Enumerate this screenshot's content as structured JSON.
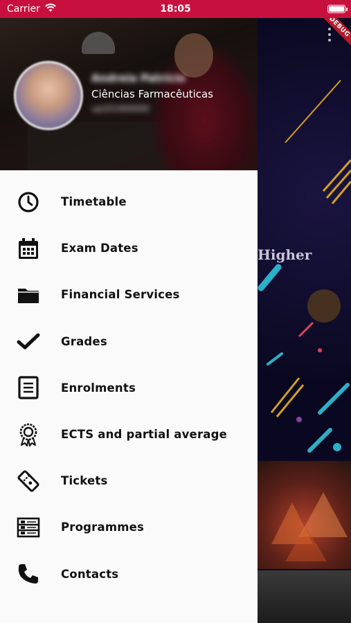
{
  "status_bar": {
    "carrier": "Carrier",
    "time": "18:05"
  },
  "debug_banner": "DEBUG",
  "background": {
    "heading_fragment": "Higher"
  },
  "profile": {
    "name": "Andreia Patrício",
    "course": "Ciências Farmacêuticas",
    "extra": "up201900000"
  },
  "menu": {
    "items": [
      {
        "label": "Timetable",
        "icon": "clock-icon"
      },
      {
        "label": "Exam Dates",
        "icon": "calendar-icon"
      },
      {
        "label": "Financial Services",
        "icon": "folder-icon"
      },
      {
        "label": "Grades",
        "icon": "checkmark-icon"
      },
      {
        "label": "Enrolments",
        "icon": "document-icon"
      },
      {
        "label": "ECTS and partial average",
        "icon": "award-badge-icon"
      },
      {
        "label": "Tickets",
        "icon": "ticket-icon"
      },
      {
        "label": "Programmes",
        "icon": "list-icon"
      },
      {
        "label": "Contacts",
        "icon": "phone-icon"
      }
    ]
  },
  "colors": {
    "status_bar": "#c8103e",
    "drawer_bg": "#fafafa",
    "menu_text": "#111111"
  }
}
